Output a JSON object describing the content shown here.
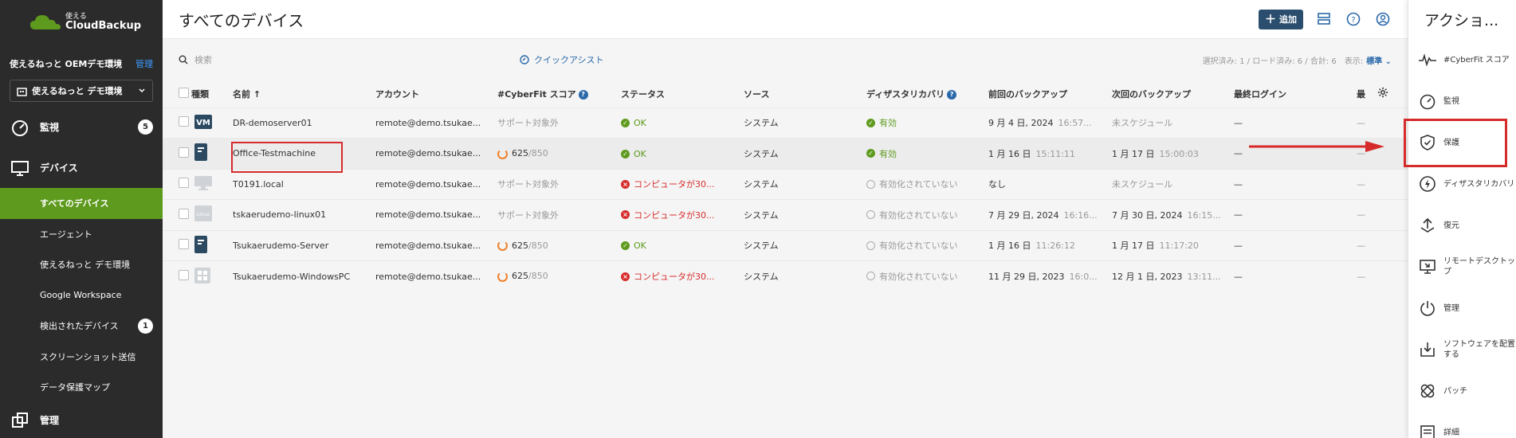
{
  "brand": {
    "small": "使える",
    "big": "CloudBackup"
  },
  "sidebar": {
    "tenant_name": "使えるねっと OEMデモ環境",
    "tenant_manage": "管理",
    "tenant_select": "使えるねっと デモ環境",
    "monitor": {
      "label": "監視",
      "badge": "5"
    },
    "devices": {
      "label": "デバイス"
    },
    "items": [
      {
        "label": "すべてのデバイス"
      },
      {
        "label": "エージェント"
      },
      {
        "label": "使えるねっと デモ環境"
      },
      {
        "label": "Google Workspace"
      },
      {
        "label": "検出されたデバイス",
        "badge": "1"
      },
      {
        "label": "スクリーンショット送信"
      },
      {
        "label": "データ保護マップ"
      }
    ],
    "manage": {
      "label": "管理"
    }
  },
  "header": {
    "title": "すべてのデバイス",
    "add_label": "追加"
  },
  "toolbar": {
    "search_placeholder": "検索",
    "quick_assist": "クイックアシスト",
    "counts": "選択済み: 1 / ロード済み: 6 / 合計: 6",
    "view_label": "表示:",
    "view_value": "標準"
  },
  "table": {
    "headers": {
      "type": "種類",
      "name": "名前 ↑",
      "account": "アカウント",
      "cyberfit": "#CyberFit スコア",
      "status": "ステータス",
      "source": "ソース",
      "dr": "ディザスタリカバリ",
      "prev_backup": "前回のバックアップ",
      "next_backup": "次回のバックアップ",
      "last_login": "最終ログイン",
      "last": "最"
    },
    "rows": [
      {
        "type_label": "VM",
        "name": "DR-demoserver01",
        "account": "remote@demo.tsukae...",
        "score": "サポート対象外",
        "score_max": "",
        "status": "OK",
        "source": "システム",
        "dr": "有効",
        "prev_date": "9 月 4 日, 2024",
        "prev_time": "16:57...",
        "next_date": "未スケジュール",
        "next_time": "",
        "login": "—",
        "last": "—"
      },
      {
        "type_label": "",
        "name": "Office-Testmachine",
        "account": "remote@demo.tsukae...",
        "score": "625",
        "score_max": "/850",
        "status": "OK",
        "source": "システム",
        "dr": "有効",
        "prev_date": "1 月 16 日",
        "prev_time": "15:11:11",
        "next_date": "1 月 17 日",
        "next_time": "15:00:03",
        "login": "—",
        "last": "—"
      },
      {
        "type_label": "",
        "name": "T0191.local",
        "account": "remote@demo.tsukae...",
        "score": "サポート対象外",
        "score_max": "",
        "status": "コンピュータが30...",
        "source": "システム",
        "dr": "有効化されていない",
        "prev_date": "なし",
        "prev_time": "",
        "next_date": "未スケジュール",
        "next_time": "",
        "login": "—",
        "last": "—"
      },
      {
        "type_label": "Linux",
        "name": "tskaerudemo-linux01",
        "account": "remote@demo.tsukae...",
        "score": "サポート対象外",
        "score_max": "",
        "status": "コンピュータが30...",
        "source": "システム",
        "dr": "有効化されていない",
        "prev_date": "7 月 29 日, 2024",
        "prev_time": "16:16...",
        "next_date": "7 月 30 日, 2024",
        "next_time": "16:15...",
        "login": "—",
        "last": "—"
      },
      {
        "type_label": "",
        "name": "Tsukaerudemo-Server",
        "account": "remote@demo.tsukae...",
        "score": "625",
        "score_max": "/850",
        "status": "OK",
        "source": "システム",
        "dr": "有効化されていない",
        "prev_date": "1 月 16 日",
        "prev_time": "11:26:12",
        "next_date": "1 月 17 日",
        "next_time": "11:17:20",
        "login": "—",
        "last": "—"
      },
      {
        "type_label": "",
        "name": "Tsukaerudemo-WindowsPC",
        "account": "remote@demo.tsukae...",
        "score": "625",
        "score_max": "/850",
        "status": "コンピュータが30...",
        "source": "システム",
        "dr": "有効化されていない",
        "prev_date": "11 月 29 日, 2023",
        "prev_time": "16:0...",
        "next_date": "12 月 1 日, 2023",
        "next_time": "13:11...",
        "login": "—",
        "last": "—"
      }
    ]
  },
  "actions": {
    "title": "アクショ...",
    "items": [
      {
        "label": "#CyberFit スコア"
      },
      {
        "label": "監視"
      },
      {
        "label": "保護"
      },
      {
        "label": "ディザスタリカバリ"
      },
      {
        "label": "復元"
      },
      {
        "label": "リモートデスクトップ"
      },
      {
        "label": "管理"
      },
      {
        "label": "ソフトウェアを配置する"
      },
      {
        "label": "パッチ"
      },
      {
        "label": "詳細"
      }
    ]
  },
  "colors": {
    "accent_green": "#5e9a1e",
    "sidebar_bg": "#2b2b2b",
    "error_red": "#d72d2d",
    "link_blue": "#2b6aaa",
    "highlight_red": "#d62b2b"
  }
}
